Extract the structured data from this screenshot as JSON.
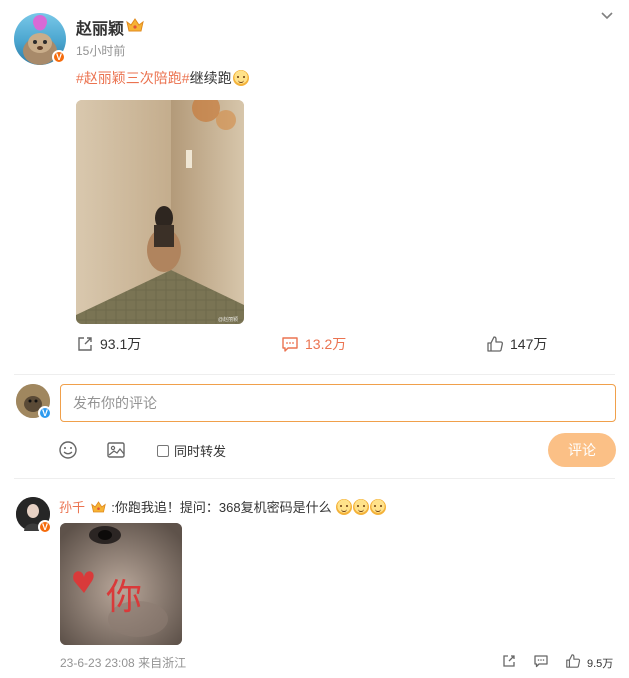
{
  "post": {
    "author": "赵丽颖",
    "time": "15小时前",
    "hashtag": "#赵丽颖三次陪跑#",
    "text": "继续跑",
    "image_watermark": "@赵丽颖",
    "actions": {
      "repost_count": "93.1万",
      "comment_count": "13.2万",
      "like_count": "147万"
    }
  },
  "compose": {
    "placeholder": "发布你的评论",
    "repost_label": "同时转发",
    "submit_label": "评论"
  },
  "comment": {
    "user": "孙千",
    "text": ":你跑我追！提问：368复机密码是什么",
    "image_text": "你",
    "date": "23-6-23 23:08",
    "source": "来自浙江",
    "like_count": "9.5万"
  },
  "icons": {
    "verified_badge": "verified-badge-icon",
    "crown": "crown-icon",
    "more": "chevron-down-icon",
    "repost": "repost-icon",
    "comment": "comment-icon",
    "like": "thumbs-up-icon",
    "emoji": "emoji-icon",
    "picture": "picture-icon",
    "reply": "reply-icon"
  },
  "colors": {
    "accent": "#eb7350",
    "submit_disabled": "#fbc086",
    "input_border": "#f0a04b",
    "verified_orange": "#f56b0c",
    "verified_blue": "#2e9bf0",
    "meta_text": "#939393"
  }
}
